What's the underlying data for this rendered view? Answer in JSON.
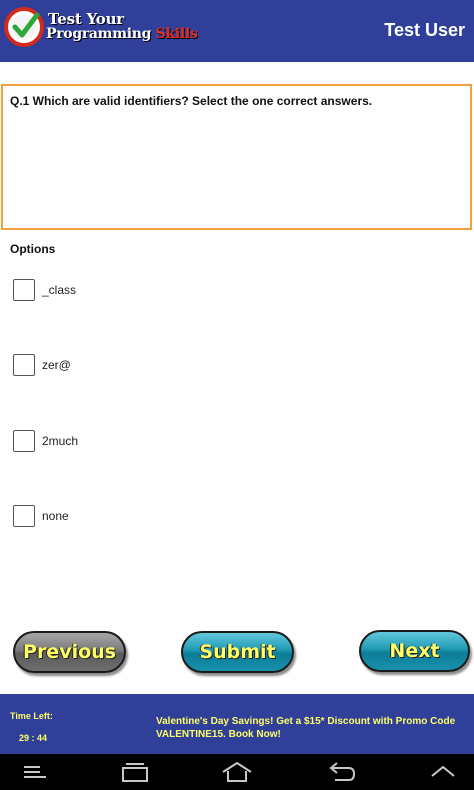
{
  "header": {
    "logo_line1": "Test Your",
    "logo_line2_main": "Programming",
    "logo_line2_accent": "Skills",
    "user_name": "Test User"
  },
  "question": {
    "text": "Q.1  Which are valid identifiers? Select the one correct answers."
  },
  "options": {
    "label": "Options",
    "items": [
      {
        "label": "_class",
        "checked": false
      },
      {
        "label": "zer@",
        "checked": false
      },
      {
        "label": "2much",
        "checked": false
      },
      {
        "label": "none",
        "checked": false
      }
    ]
  },
  "buttons": {
    "previous": "Previous",
    "submit": "Submit",
    "next": "Next"
  },
  "footer": {
    "time_label": "Time Left:",
    "time_value": "29 : 44",
    "promo_text": "Valentine's Day Savings! Get a $15* Discount with Promo Code VALENTINE15. Book Now!"
  },
  "navbar": {
    "icons": [
      "menu-icon",
      "recent-apps-icon",
      "home-icon",
      "back-icon",
      "collapse-icon"
    ]
  },
  "colors": {
    "header_bg": "#2f3f9a",
    "question_border": "#f0a040",
    "button_text": "#ffff66",
    "footer_text": "#ffff66",
    "logo_accent": "#e32d1e"
  }
}
